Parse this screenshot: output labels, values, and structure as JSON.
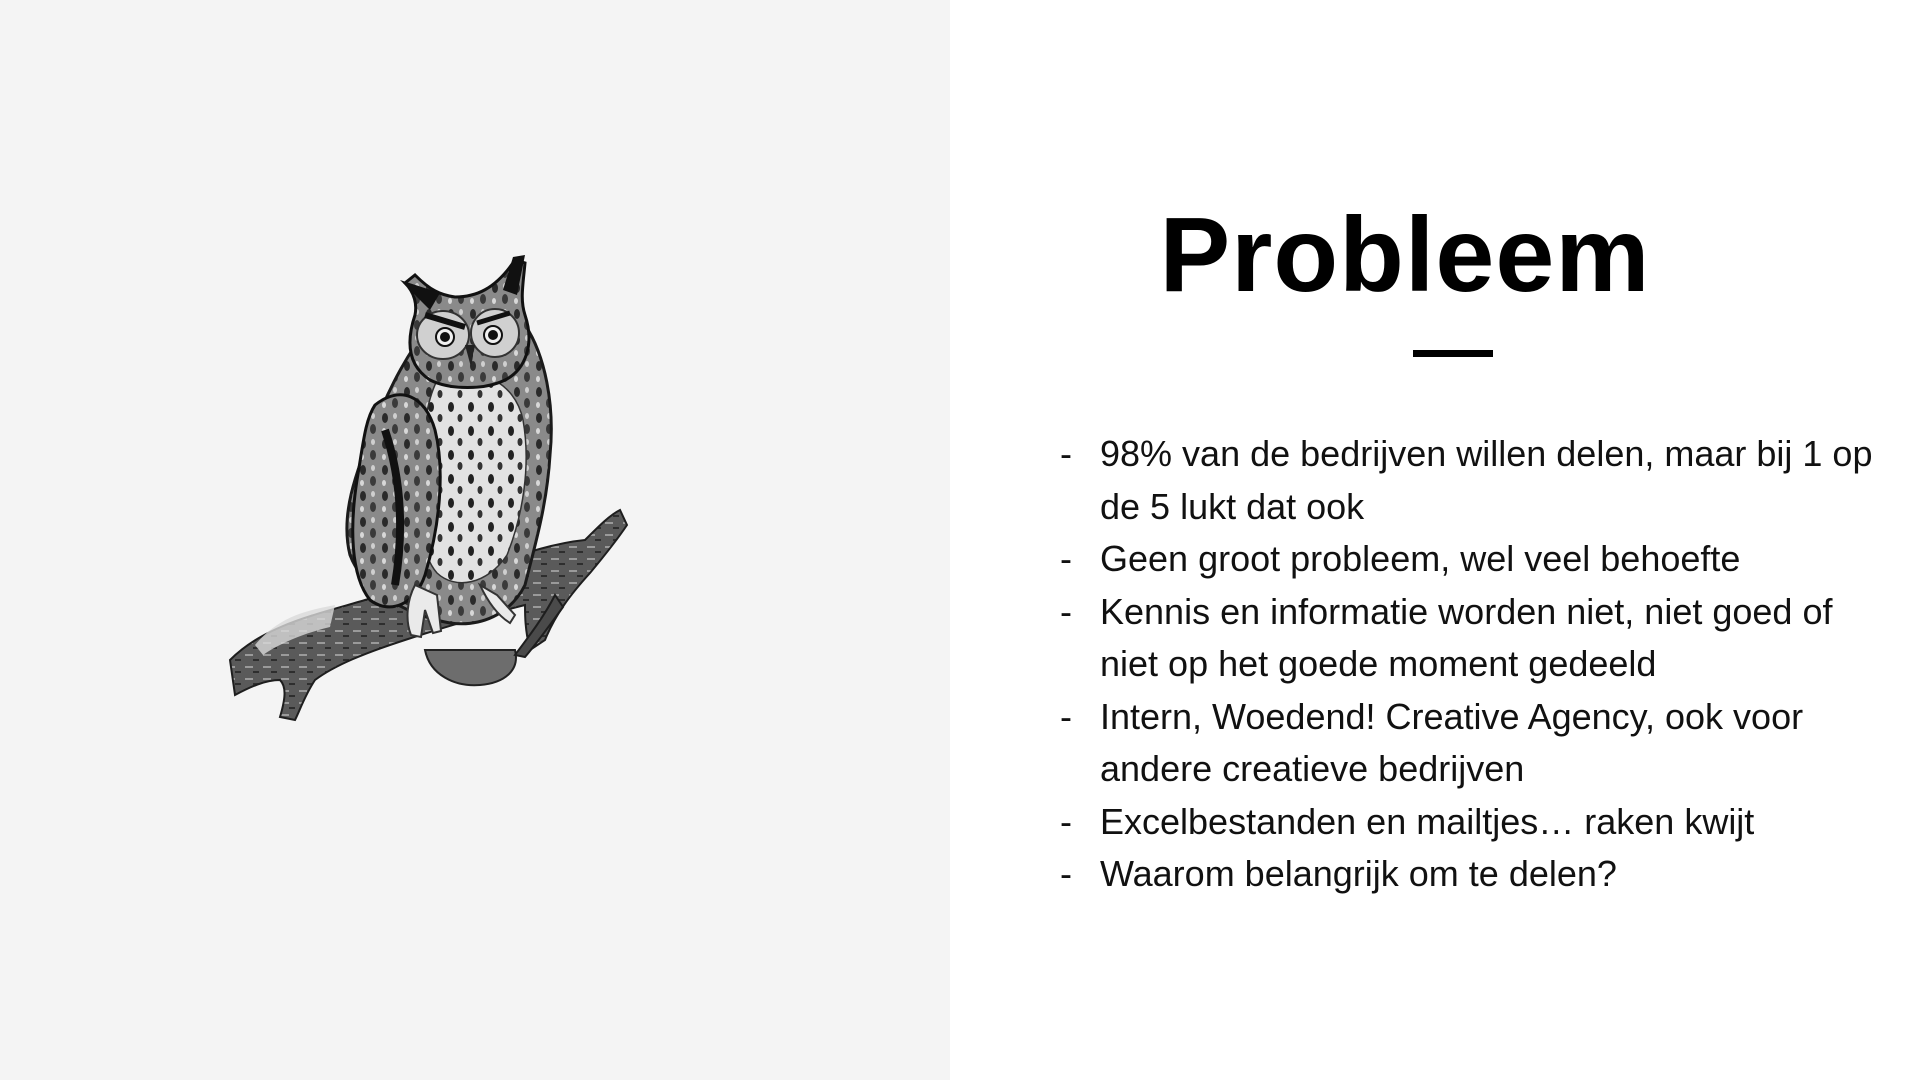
{
  "slide": {
    "title": "Probleem",
    "bullet_marker": "-",
    "bullets": [
      "98% van de bedrijven willen delen, maar bij 1 op de 5 lukt dat ook",
      "Geen groot probleem, wel veel behoefte",
      "Kennis en informatie worden niet, niet goed of niet op het goede moment gedeeld",
      "Intern, Woedend! Creative Agency, ook voor andere creatieve bedrijven",
      "Excelbestanden en mailtjes… raken kwijt",
      "Waarom belangrijk om te delen?"
    ]
  },
  "image": {
    "icon": "owl-illustration"
  },
  "colors": {
    "left_background": "#f4f4f4",
    "right_background": "#ffffff",
    "text": "#000000"
  }
}
